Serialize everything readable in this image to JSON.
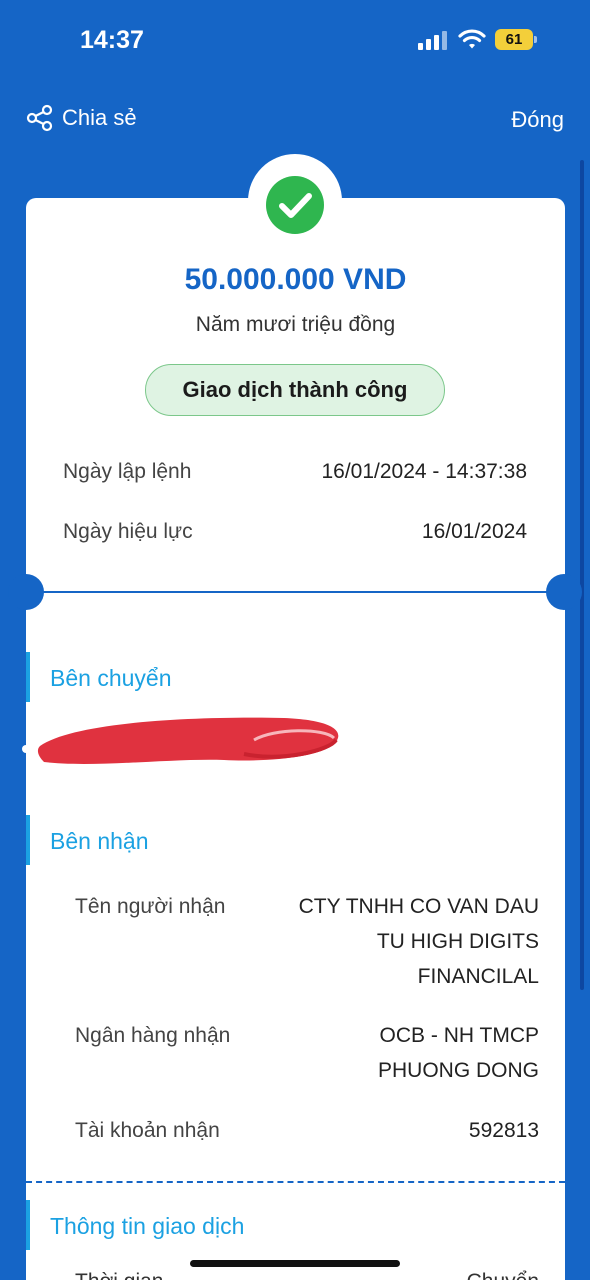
{
  "status_bar": {
    "time": "14:37",
    "battery": "61"
  },
  "header": {
    "share_label": "Chia sẻ",
    "close_label": "Đóng"
  },
  "transaction": {
    "amount": "50.000.000 VND",
    "amount_words": "Năm mươi triệu đồng",
    "status": "Giao dịch thành công",
    "rows": [
      {
        "label": "Ngày lập lệnh",
        "value": "16/01/2024 - 14:37:38"
      },
      {
        "label": "Ngày hiệu lực",
        "value": "16/01/2024"
      }
    ]
  },
  "sender": {
    "title": "Bên chuyển"
  },
  "receiver": {
    "title": "Bên nhận",
    "name_label": "Tên người nhận",
    "name_lines": [
      "CTY TNHH CO VAN DAU",
      "TU HIGH DIGITS",
      "FINANCILAL"
    ],
    "bank_label": "Ngân hàng nhận",
    "bank_lines": [
      "OCB - NH TMCP",
      "PHUONG DONG"
    ],
    "account_label": "Tài khoản nhận",
    "account_value": "592813"
  },
  "info": {
    "title": "Thông tin giao dịch",
    "cut_label": "Thời gian",
    "cut_value": "Chuyển"
  },
  "colors": {
    "brand_blue": "#1565c6",
    "accent_cyan": "#1ba1e2",
    "success_green": "#2fb64f",
    "redaction_red": "#e0323f"
  }
}
